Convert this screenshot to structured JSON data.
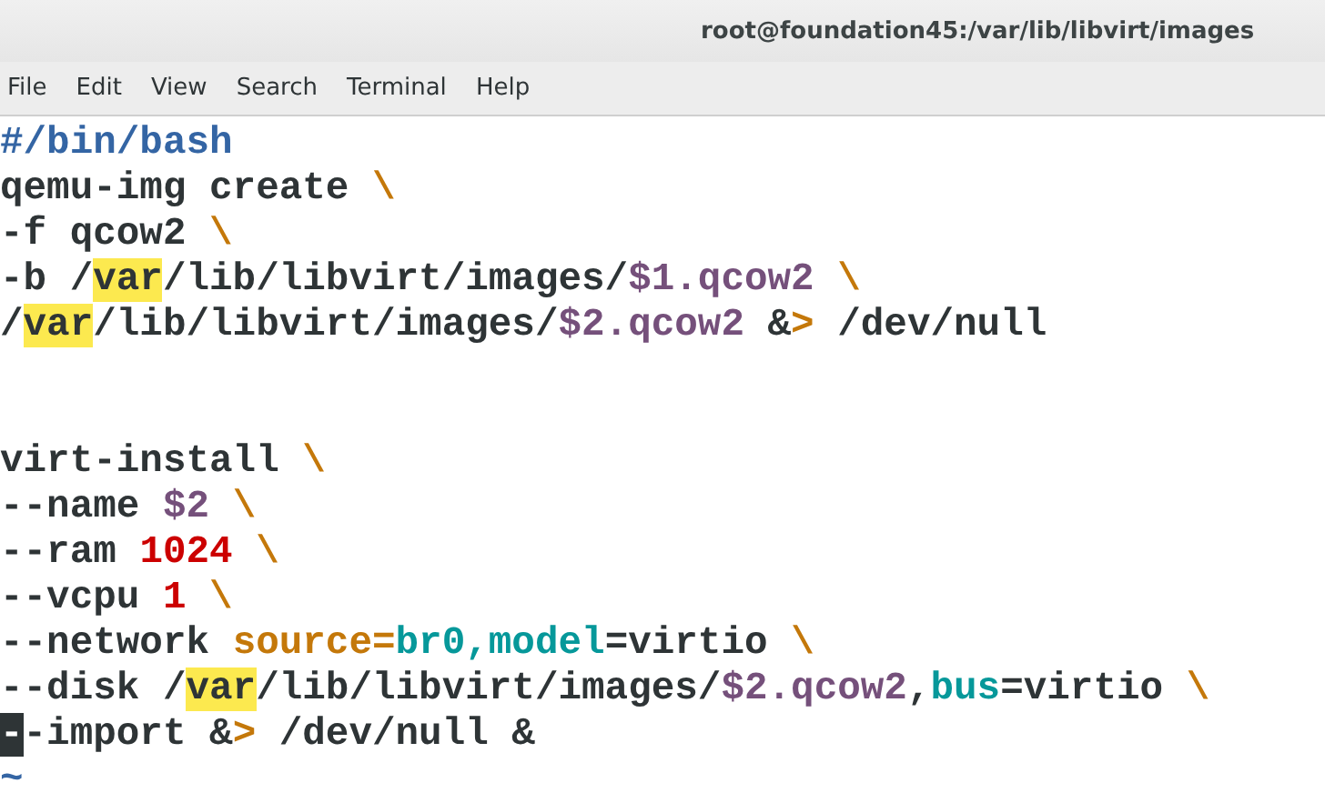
{
  "window": {
    "title": "root@foundation45:/var/lib/libvirt/images"
  },
  "menu": [
    "File",
    "Edit",
    "View",
    "Search",
    "Terminal",
    "Help"
  ],
  "lines": [
    {
      "kind": "code",
      "segments": [
        {
          "text": "#/bin/bash",
          "kind": "comment"
        }
      ]
    },
    {
      "kind": "code",
      "segments": [
        {
          "text": "qemu-img create ",
          "kind": "plain"
        },
        {
          "text": "\\",
          "kind": "op"
        }
      ]
    },
    {
      "kind": "code",
      "segments": [
        {
          "text": "-f qcow2 ",
          "kind": "plain"
        },
        {
          "text": "\\",
          "kind": "op"
        }
      ]
    },
    {
      "kind": "code",
      "segments": [
        {
          "text": "-b /",
          "kind": "plain"
        },
        {
          "text": "var",
          "kind": "match"
        },
        {
          "text": "/lib/libvirt/images/",
          "kind": "plain"
        },
        {
          "text": "$1.qcow2 ",
          "kind": "var"
        },
        {
          "text": "\\",
          "kind": "op"
        }
      ]
    },
    {
      "kind": "code",
      "segments": [
        {
          "text": "/",
          "kind": "plain"
        },
        {
          "text": "var",
          "kind": "match"
        },
        {
          "text": "/lib/libvirt/images/",
          "kind": "plain"
        },
        {
          "text": "$2.qcow2",
          "kind": "var"
        },
        {
          "text": " &",
          "kind": "plain"
        },
        {
          "text": ">",
          "kind": "op"
        },
        {
          "text": " /dev/null",
          "kind": "plain"
        }
      ]
    },
    {
      "kind": "blank"
    },
    {
      "kind": "blank"
    },
    {
      "kind": "code",
      "segments": [
        {
          "text": "virt-install ",
          "kind": "plain"
        },
        {
          "text": "\\",
          "kind": "op"
        }
      ]
    },
    {
      "kind": "code",
      "segments": [
        {
          "text": "--name ",
          "kind": "plain"
        },
        {
          "text": "$2 ",
          "kind": "var"
        },
        {
          "text": "\\",
          "kind": "op"
        }
      ]
    },
    {
      "kind": "code",
      "segments": [
        {
          "text": "--ram ",
          "kind": "plain"
        },
        {
          "text": "1024 ",
          "kind": "num"
        },
        {
          "text": "\\",
          "kind": "op"
        }
      ]
    },
    {
      "kind": "code",
      "segments": [
        {
          "text": "--vcpu ",
          "kind": "plain"
        },
        {
          "text": "1 ",
          "kind": "num"
        },
        {
          "text": "\\",
          "kind": "op"
        }
      ]
    },
    {
      "kind": "code",
      "segments": [
        {
          "text": "--network ",
          "kind": "plain"
        },
        {
          "text": "source=",
          "kind": "op"
        },
        {
          "text": "br0,model",
          "kind": "ident"
        },
        {
          "text": "=virtio ",
          "kind": "plain"
        },
        {
          "text": "\\",
          "kind": "op"
        }
      ]
    },
    {
      "kind": "code",
      "segments": [
        {
          "text": "--disk /",
          "kind": "plain"
        },
        {
          "text": "var",
          "kind": "match"
        },
        {
          "text": "/lib/libvirt/images/",
          "kind": "plain"
        },
        {
          "text": "$2.qcow2",
          "kind": "var"
        },
        {
          "text": ",",
          "kind": "plain"
        },
        {
          "text": "bus",
          "kind": "ident"
        },
        {
          "text": "=virtio ",
          "kind": "plain"
        },
        {
          "text": "\\",
          "kind": "op"
        }
      ]
    },
    {
      "kind": "code",
      "segments": [
        {
          "text": "-",
          "kind": "cursor"
        },
        {
          "text": "-import &",
          "kind": "plain"
        },
        {
          "text": ">",
          "kind": "op"
        },
        {
          "text": " /dev/null &",
          "kind": "plain"
        }
      ]
    },
    {
      "kind": "code",
      "segments": [
        {
          "text": "~",
          "kind": "tilde"
        }
      ]
    }
  ]
}
